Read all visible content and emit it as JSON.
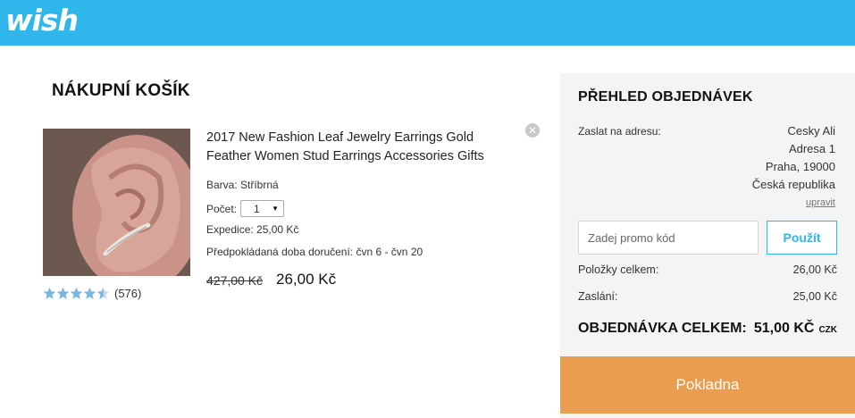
{
  "header": {
    "logo": "wish",
    "bg_color": "#2fb7ec"
  },
  "cart": {
    "title": "NÁKUPNÍ KOŠÍK",
    "item": {
      "name": "2017 New Fashion Leaf Jewelry Earrings Gold Feather Women Stud Earrings Accessories Gifts",
      "color_label": "Barva: Stříbrná",
      "qty_label": "Počet:",
      "qty_value": "1",
      "shipping_label": "Expedice: 25,00 Kč",
      "delivery_label": "Předpokládaná doba doručení: čvn 6 - čvn 20",
      "old_price": "427,00 Kč",
      "price": "26,00 Kč",
      "rating_value": 4.5,
      "rating_count": "(576)",
      "remove_icon": "close-circle-icon",
      "star_color": "#7ab7e0"
    }
  },
  "summary": {
    "title": "PŘEHLED OBJEDNÁVEK",
    "ship_to_label": "Zaslat na adresu:",
    "address": [
      "Cesky Ali",
      "Adresa 1",
      "Praha, 19000",
      "Česká republika"
    ],
    "edit_link": "upravit",
    "promo_placeholder": "Zadej promo kód",
    "promo_button": "Použít",
    "items_total_label": "Položky celkem:",
    "items_total_value": "26,00 Kč",
    "shipping_label": "Zaslání:",
    "shipping_value": "25,00 Kč",
    "order_total_label": "OBJEDNÁVKA CELKEM:",
    "order_total_value": "51,00 KČ",
    "order_total_currency": "CZK",
    "accent_color": "#2fb7ec"
  },
  "checkout": {
    "label": "Pokladna",
    "color": "#ea9d4f"
  }
}
